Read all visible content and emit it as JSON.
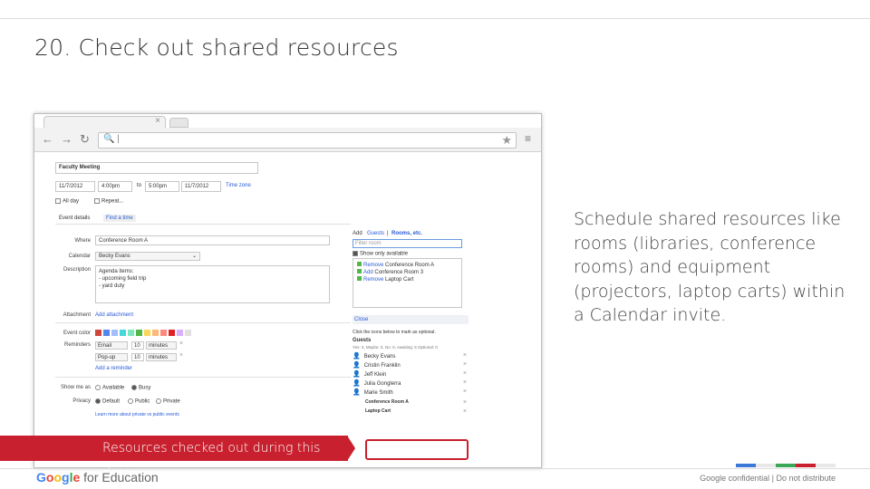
{
  "slide": {
    "title": "20. Check out shared resources",
    "body": "Schedule shared resources like rooms (libraries, conference rooms) and equipment (projectors, laptop carts) within a Calendar invite.",
    "callout": "Resources checked out during this time",
    "brand_google": "Google",
    "brand_suffix": " for Education",
    "footer": "Google confidential | Do not distribute",
    "strip_colors": [
      "#3c78d8",
      "#e8e8e8",
      "#3aa757",
      "#c8202e",
      "#e8e8e8"
    ]
  },
  "browser": {
    "tab_close": "×",
    "omnibox_search": "🔍 |",
    "icons": [
      "back-arrow-icon",
      "forward-arrow-icon",
      "reload-icon",
      "star-icon",
      "menu-icon"
    ]
  },
  "event": {
    "title_value": "Faculty Meeting",
    "start_date": "11/7/2012",
    "start_time": "4:00pm",
    "to": "to",
    "end_time": "5:00pm",
    "end_date": "11/7/2012",
    "time_zone": "Time zone",
    "all_day": "All day",
    "repeat": "Repeat...",
    "tabs": [
      "Event details",
      "Find a time"
    ],
    "where_label": "Where",
    "where_value": "Conference Room A",
    "calendar_label": "Calendar",
    "calendar_value": "Becky Evans",
    "description_label": "Description",
    "description_lines": [
      "Agenda items:",
      "- upcoming field trip",
      "- yard duty"
    ],
    "attachment_label": "Attachment",
    "attachment_link": "Add attachment",
    "event_color_label": "Event color",
    "event_colors": [
      "#d0463b",
      "#5484ed",
      "#a4bdfc",
      "#46d6db",
      "#7ae7bf",
      "#51b749",
      "#fbd75b",
      "#ffb878",
      "#ff887c",
      "#dc2127",
      "#dbadff",
      "#e1e1e1"
    ],
    "reminders_label": "Reminders",
    "reminders": [
      {
        "type": "Email",
        "amount": "10",
        "unit": "minutes"
      },
      {
        "type": "Pop-up",
        "amount": "10",
        "unit": "minutes"
      }
    ],
    "add_reminder": "Add a reminder",
    "show_me_as_label": "Show me as",
    "show_options": [
      "Available",
      "Busy"
    ],
    "privacy_label": "Privacy",
    "privacy_options": [
      "Default",
      "Public",
      "Private"
    ],
    "privacy_link": "Learn more about private vs public events"
  },
  "guests_panel": {
    "add": "Add",
    "guests": "Guests",
    "rooms": "Rooms, etc.",
    "filter_placeholder": "Filter room",
    "show_only_available": "Show only available",
    "rooms_list": [
      {
        "action": "Remove",
        "name": "Conference Room A"
      },
      {
        "action": "Add",
        "name": "Conference Room 3"
      },
      {
        "action": "Remove",
        "name": "Laptop Cart"
      }
    ],
    "close": "Close",
    "optional_hint": "Click the icons below to mark as optional.",
    "guests_heading": "Guests",
    "rsvp_counts": "Yes: 0, Maybe: 0, No: 0, Awaiting: 5  Optional: 0",
    "guest_list": [
      "Becky Evans",
      "Cristin Franklin",
      "Jeff Klein",
      "Julia Gonglerra",
      "Marie Smith"
    ],
    "resource_list": [
      "Conference Room A",
      "Laptop Cart"
    ],
    "remove_glyph": "×"
  }
}
